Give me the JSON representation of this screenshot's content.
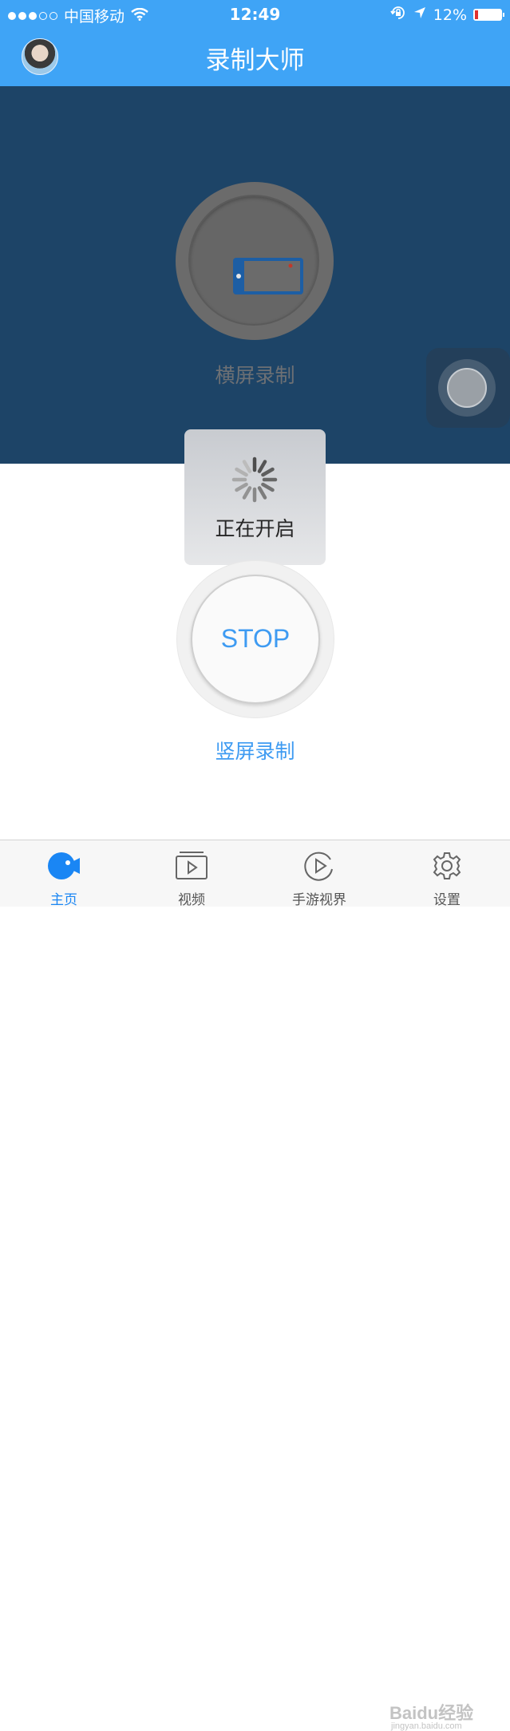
{
  "status_bar": {
    "carrier": "中国移动",
    "time": "12:49",
    "battery_percent": "12%",
    "signal_bars": 3,
    "signal_total": 5,
    "battery_level": 0.12,
    "icons": [
      "wifi-icon",
      "orientation-lock-icon",
      "location-arrow-icon",
      "battery-icon"
    ]
  },
  "nav": {
    "title": "录制大师",
    "avatar_icon": "user-avatar"
  },
  "landscape": {
    "label": "横屏录制",
    "icon": "landscape-phone-icon"
  },
  "loading": {
    "text": "正在开启",
    "icon": "spinner-icon"
  },
  "portrait": {
    "button_label": "STOP",
    "label": "竖屏录制"
  },
  "tabs": [
    {
      "label": "主页",
      "icon": "home-camera-icon",
      "active": true
    },
    {
      "label": "视频",
      "icon": "video-icon",
      "active": false
    },
    {
      "label": "手游视界",
      "icon": "play-circle-icon",
      "active": false
    },
    {
      "label": "设置",
      "icon": "gear-icon",
      "active": false
    }
  ],
  "watermark": {
    "text": "Baidu经验",
    "sub": "jingyan.baidu.com"
  },
  "colors": {
    "accent": "#3fa4f6",
    "dark_panel": "#1d4467",
    "active_tab": "#1a86f4",
    "stop_text": "#3e9bf2"
  }
}
